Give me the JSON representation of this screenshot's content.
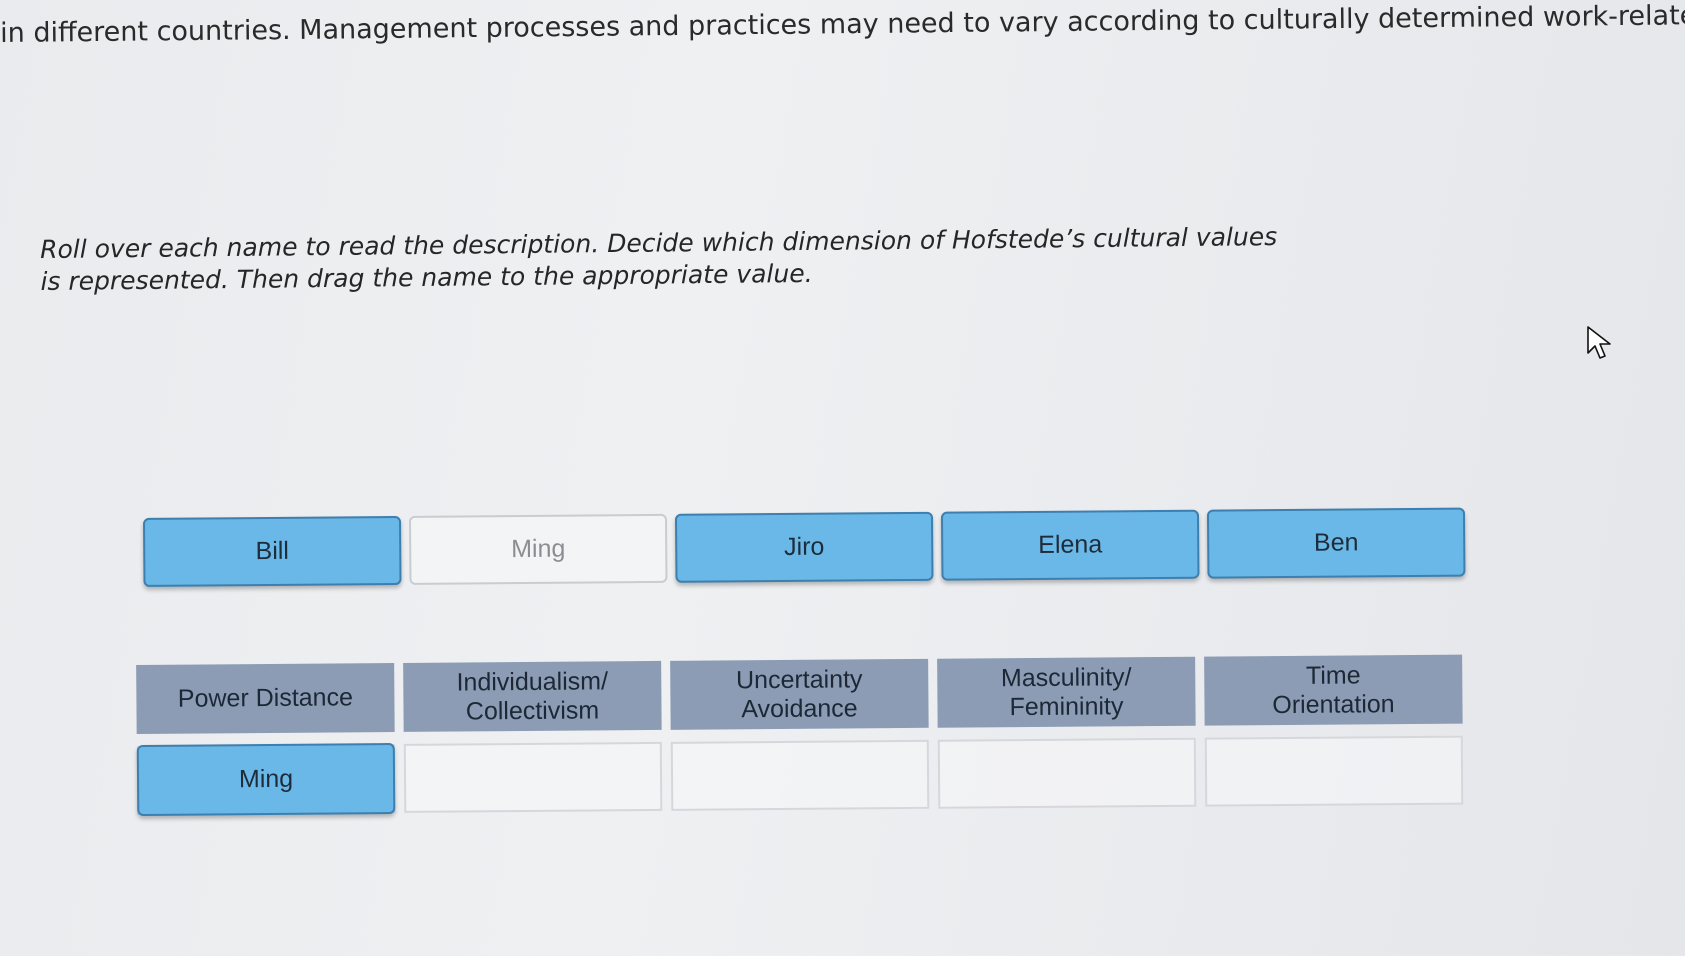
{
  "intro_text": "in different countries. Management processes and practices may need to vary according to culturally determined work-related v",
  "instructions": "Roll over each name to read the description. Decide which dimension of Hofstede’s cultural values is represented. Then drag the name to the appropriate value.",
  "names": [
    {
      "label": "Bill",
      "state": "available"
    },
    {
      "label": "Ming",
      "state": "placed"
    },
    {
      "label": "Jiro",
      "state": "available"
    },
    {
      "label": "Elena",
      "state": "available"
    },
    {
      "label": "Ben",
      "state": "available"
    }
  ],
  "values": [
    {
      "label": "Power Distance",
      "dropped": "Ming"
    },
    {
      "label": "Individualism/\nCollectivism",
      "dropped": ""
    },
    {
      "label": "Uncertainty\nAvoidance",
      "dropped": ""
    },
    {
      "label": "Masculinity/\nFemininity",
      "dropped": ""
    },
    {
      "label": "Time\nOrientation",
      "dropped": ""
    }
  ],
  "colors": {
    "tile_active": "#6ab8e8",
    "tile_border": "#3d7fae",
    "header_bg": "#8c9cb4"
  },
  "icons": {
    "cursor": "arrow-cursor-icon"
  }
}
